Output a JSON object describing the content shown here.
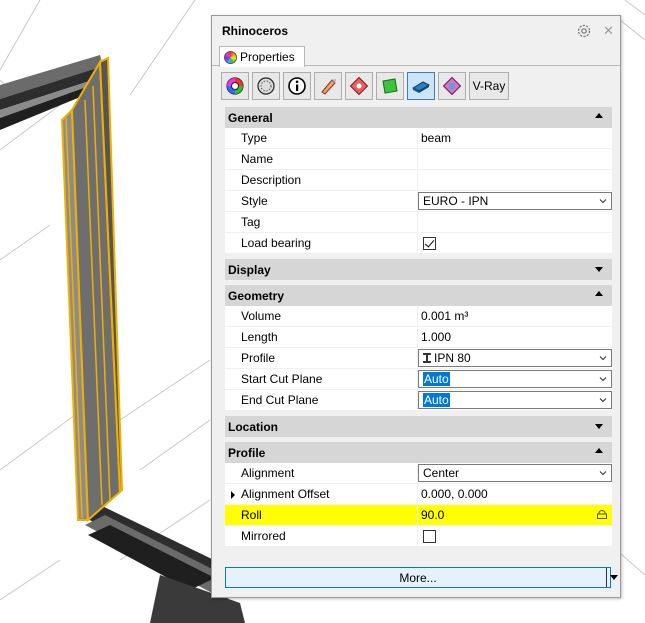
{
  "window": {
    "title": "Rhinoceros"
  },
  "tabs": [
    {
      "label": "Properties",
      "icon": "color-wheel-icon"
    }
  ],
  "toolbar": {
    "buttons": [
      {
        "icon": "object-properties-icon"
      },
      {
        "icon": "material-icon"
      },
      {
        "icon": "info-icon"
      },
      {
        "icon": "paint-icon"
      },
      {
        "icon": "decal-icon"
      },
      {
        "icon": "green-layer-icon"
      },
      {
        "icon": "beam-properties-icon",
        "active": true
      },
      {
        "icon": "texture-mapping-icon"
      }
    ],
    "vray_label": "V-Ray"
  },
  "sections": {
    "general": {
      "title": "General",
      "rows": [
        {
          "label": "Type",
          "value": "beam"
        },
        {
          "label": "Name",
          "value": ""
        },
        {
          "label": "Description",
          "value": ""
        },
        {
          "label": "Style",
          "value": "EURO - IPN"
        },
        {
          "label": "Tag",
          "value": ""
        },
        {
          "label": "Load bearing",
          "checked": true
        }
      ]
    },
    "display": {
      "title": "Display"
    },
    "geometry": {
      "title": "Geometry",
      "rows": [
        {
          "label": "Volume",
          "value": "0.001 m³"
        },
        {
          "label": "Length",
          "value": "1.000"
        },
        {
          "label": "Profile",
          "value": "IPN 80"
        },
        {
          "label": "Start Cut Plane",
          "value": "Auto"
        },
        {
          "label": "End Cut Plane",
          "value": "Auto"
        }
      ]
    },
    "location": {
      "title": "Location"
    },
    "profile": {
      "title": "Profile",
      "rows": [
        {
          "label": "Alignment",
          "value": "Center"
        },
        {
          "label": "Alignment Offset",
          "value": "0.000, 0.000"
        },
        {
          "label": "Roll",
          "value": "90.0"
        },
        {
          "label": "Mirrored",
          "checked": false
        }
      ]
    }
  },
  "footer": {
    "more_label": "More..."
  },
  "colors": {
    "highlight": "#ffff00",
    "selection": "#0078d7",
    "beam_highlight": "#f0b000"
  }
}
